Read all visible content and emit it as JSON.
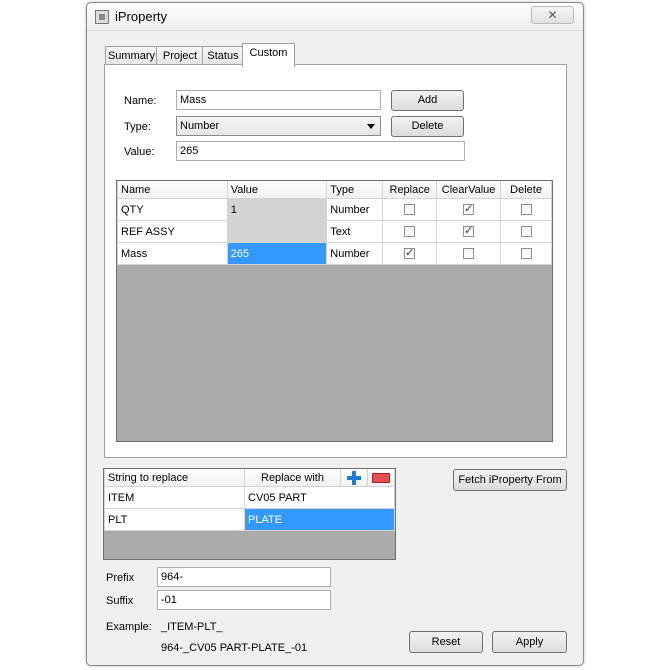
{
  "window": {
    "title": "iProperty",
    "close_glyph": "✕"
  },
  "tabs": [
    {
      "label": "Summary"
    },
    {
      "label": "Project"
    },
    {
      "label": "Status"
    },
    {
      "label": "Custom"
    }
  ],
  "form": {
    "name_label": "Name:",
    "name_value": "Mass",
    "type_label": "Type:",
    "type_value": "Number",
    "value_label": "Value:",
    "value_value": "265",
    "add_label": "Add",
    "delete_label": "Delete"
  },
  "props_grid": {
    "headers": [
      "Name",
      "Value",
      "Type",
      "Replace",
      "ClearValue",
      "Delete"
    ],
    "rows": [
      {
        "name": "QTY",
        "value": "1",
        "type": "Number",
        "replace": false,
        "clear": true,
        "delete": false
      },
      {
        "name": "REF ASSY",
        "value": "",
        "type": "Text",
        "replace": false,
        "clear": true,
        "delete": false
      },
      {
        "name": "Mass",
        "value": "265",
        "type": "Number",
        "replace": true,
        "clear": false,
        "delete": false
      }
    ]
  },
  "replace_grid": {
    "headers": [
      "String to replace",
      "Replace with"
    ],
    "rows": [
      {
        "from": "ITEM",
        "to": "CV05 PART"
      },
      {
        "from": "PLT",
        "to": "PLATE"
      }
    ]
  },
  "fetch_label": "Fetch iProperty From",
  "prefix_label": "Prefix",
  "prefix_value": "964-",
  "suffix_label": "Suffix",
  "suffix_value": "-01",
  "example_label": "Example:",
  "example_template": "_ITEM-PLT_",
  "example_result": "964-_CV05 PART-PLATE_-01",
  "reset_label": "Reset",
  "apply_label": "Apply",
  "colors": {
    "selection": "#3399ff",
    "grid_empty": "#ababab"
  }
}
